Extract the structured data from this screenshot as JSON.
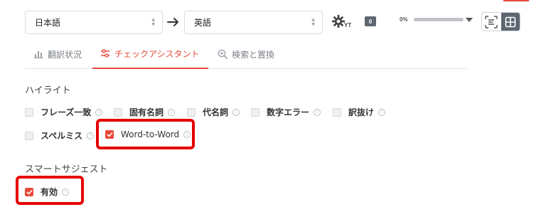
{
  "colors": {
    "accent": "#e8493b",
    "annotation_red": "#e60000",
    "dark_gray": "#5d6670"
  },
  "toolbar": {
    "source_language": "日本語",
    "target_language": "英語",
    "gear_badge": "YT",
    "counter": "0",
    "progress_label": "0%",
    "progress_value": 0
  },
  "tabs": [
    {
      "label": "翻訳状況",
      "icon": "bar-chart-icon",
      "active": false
    },
    {
      "label": "チェックアシスタント",
      "icon": "sliders-icon",
      "active": true
    },
    {
      "label": "検索と置換",
      "icon": "search-zoom-icon",
      "active": false
    }
  ],
  "highlight": {
    "title": "ハイライト",
    "options": [
      {
        "label": "フレーズ一致",
        "checked": false
      },
      {
        "label": "固有名詞",
        "checked": false
      },
      {
        "label": "代名詞",
        "checked": false
      },
      {
        "label": "数字エラー",
        "checked": false
      },
      {
        "label": "訳抜け",
        "checked": false
      },
      {
        "label": "スペルミス",
        "checked": false
      },
      {
        "label": "Word-to-Word",
        "checked": true
      }
    ]
  },
  "suggest": {
    "title": "スマートサジェスト",
    "options": [
      {
        "label": "有効",
        "checked": true
      }
    ]
  },
  "info_glyph": "i"
}
